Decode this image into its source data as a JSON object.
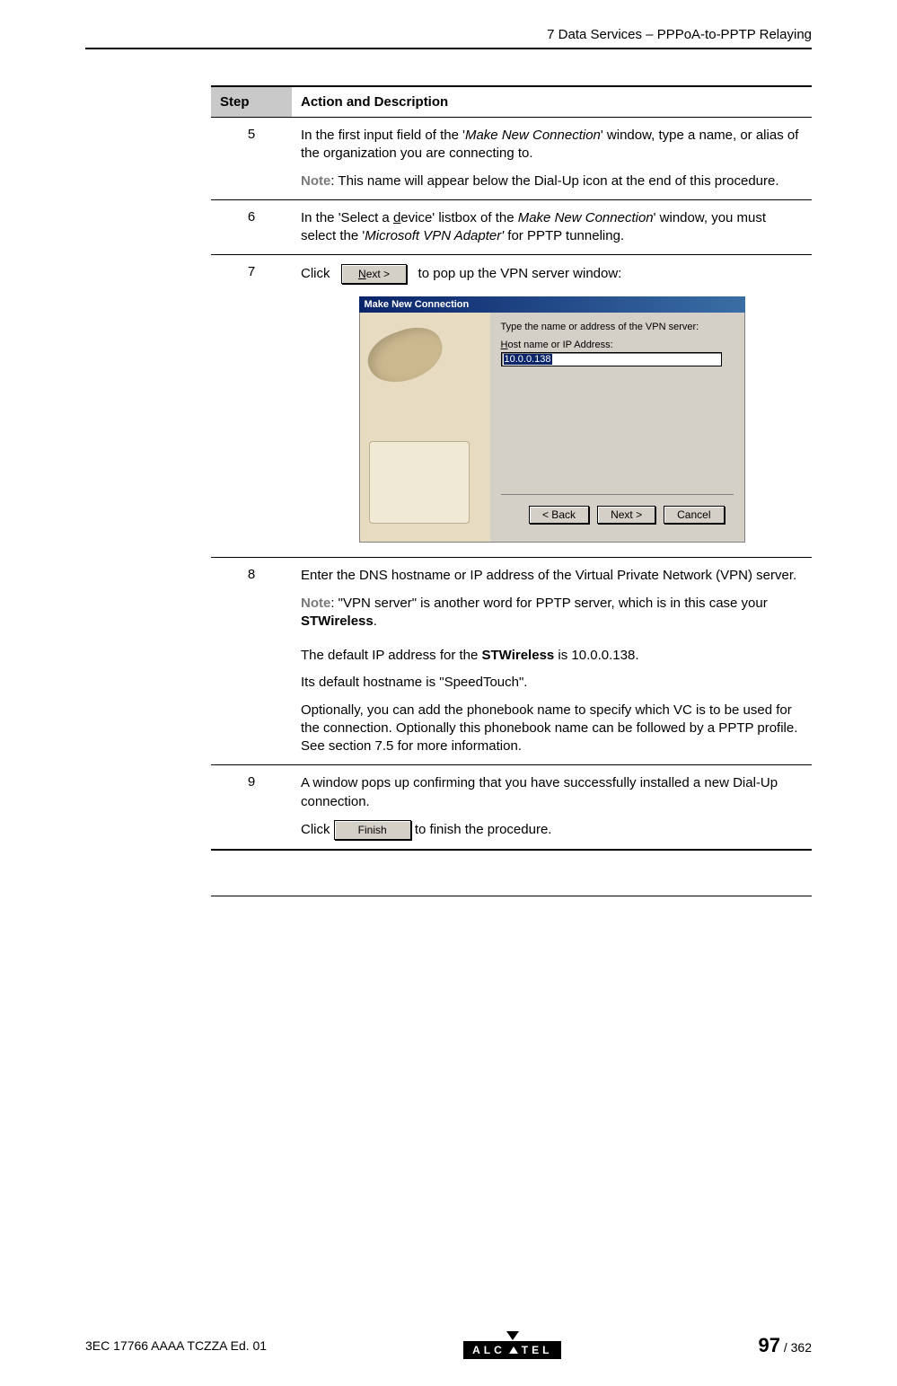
{
  "header": {
    "chapter": "7   Data Services – PPPoA-to-PPTP Relaying"
  },
  "table": {
    "head_step": "Step",
    "head_action": "Action and Description",
    "rows": [
      {
        "num": "5",
        "p1a": "In the first input field of the '",
        "p1i": "Make New Connection",
        "p1b": "' window, type a name, or alias of the organization you are connecting to.",
        "note_label": "Note",
        "note_text": ": This name will appear below the Dial-Up icon at the end of this procedure."
      },
      {
        "num": "6",
        "p1a": "In the 'Select a ",
        "p1u": "d",
        "p1b": "evice' listbox of the ",
        "p1i": "Make New Connection",
        "p1c": "' window, you must select the '",
        "p1i2": "Microsoft VPN Adapter'",
        "p1d": " for PPTP tunneling."
      },
      {
        "num": "7",
        "click": "Click",
        "btn": "Next >",
        "after": " to pop up the VPN server window:",
        "wizard": {
          "title": "Make New Connection",
          "prompt": "Type the name or address of the VPN server:",
          "label": "Host name or IP Address:",
          "value": "10.0.0.138",
          "back": "< Back",
          "next": "Next >",
          "cancel": "Cancel"
        }
      },
      {
        "num": "8",
        "p1": "Enter the DNS hostname or IP address of the Virtual Private Network (VPN) server.",
        "note_label": "Note",
        "note_a": ": \"VPN server\" is another word for PPTP server, which is in this case your ",
        "note_b": "STWireless",
        "note_c": ".",
        "p2a": "The default IP address for the ",
        "p2b": "STWireless",
        "p2c": " is 10.0.0.138.",
        "p3": "Its default hostname is \"SpeedTouch\".",
        "p4": "Optionally, you can add the phonebook name to specify which VC is to be used for the connection. Optionally this phonebook name can be followed by a PPTP profile. See section 7.5 for more information."
      },
      {
        "num": "9",
        "p1": "A window pops up confirming that you have successfully installed a new Dial-Up connection.",
        "click": "Click",
        "btn": "Finish",
        "after": " to finish the procedure."
      }
    ]
  },
  "footer": {
    "docid": "3EC 17766 AAAA TCZZA Ed. 01",
    "logo_a": "ALC",
    "logo_b": "TEL",
    "page_cur": "97",
    "page_sep": " / ",
    "page_total": "362"
  }
}
